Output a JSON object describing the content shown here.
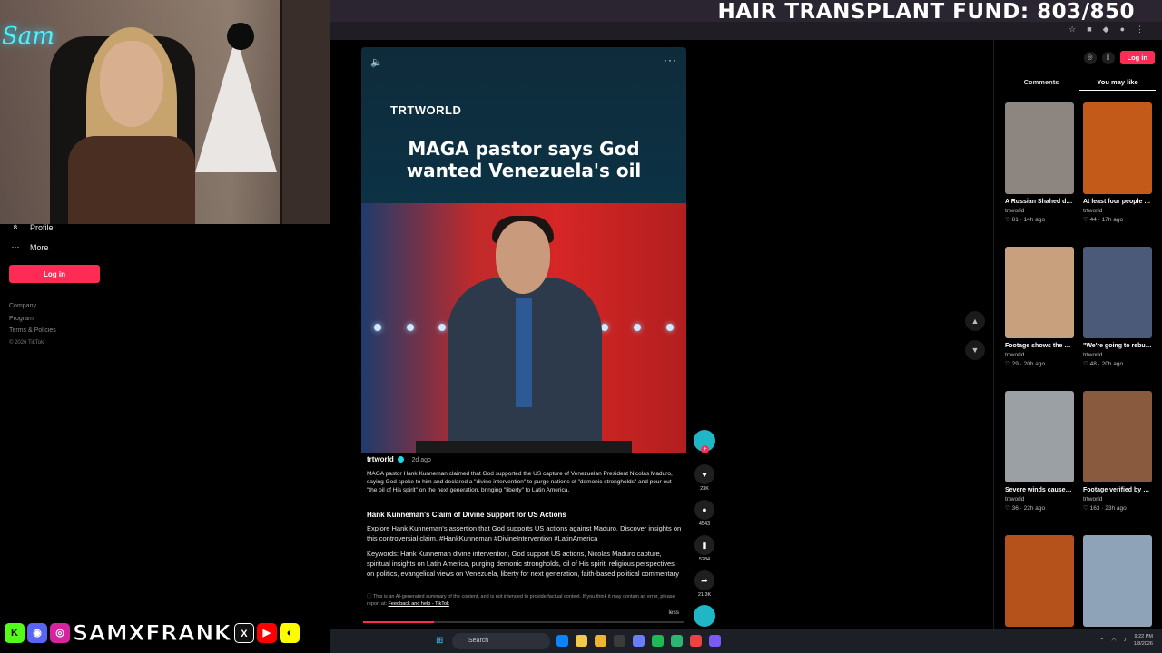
{
  "overlay": {
    "fund_title": "HAIR TRANSPLANT FUND: 803/850",
    "neon_sign": "Sam",
    "handle": "SAMXFRANK"
  },
  "sidebar": {
    "items": [
      {
        "label": "Profile",
        "icon": "person-icon"
      },
      {
        "label": "More",
        "icon": "more-dots-icon"
      }
    ],
    "login_label": "Log in",
    "footer": [
      "Company",
      "Program",
      "Terms & Policies"
    ],
    "copyright": "© 2026 TikTok"
  },
  "video": {
    "brand": "TRTWORLD",
    "headline_line1": "MAGA pastor says God",
    "headline_line2": "wanted Venezuela's oil"
  },
  "description": {
    "author": "trtworld",
    "time_ago": "2d ago",
    "caption": "MAGA pastor Hank Kunneman claimed that God supported the US capture of Venezuelan President Nicolas Maduro, saying God spoke to him and declared a \"divine intervention\" to purge nations of \"demonic strongholds\" and pour out \"the oil of His spirit\" on the next generation, bringing \"liberty\" to Latin America.",
    "section_title": "Hank Kunneman's Claim of Divine Support for US Actions",
    "section_body": "Explore Hank Kunneman's assertion that God supports US actions against Maduro. Discover insights on this controversial claim. #HankKunneman #DivineIntervention #LatinAmerica",
    "keywords": "Keywords: Hank Kunneman divine intervention, God support US actions, Nicolas Maduro capture, spiritual insights on Latin America, purging demonic strongholds, oil of His spirit, religious perspectives on politics, evangelical views on Venezuela, liberty for next generation, faith-based political commentary",
    "ai_note": "This is an AI-generated summary of the content, and is not intended to provide factual context. If you think it may contain an error, please report at:",
    "ai_link": "Feedback and help - TikTok",
    "less_label": "less",
    "progress": 0.22
  },
  "actions": {
    "likes": "23K",
    "comments": "4543",
    "saves": "5284",
    "shares": "21.3K"
  },
  "right_panel": {
    "login_label": "Log in",
    "tabs": [
      "Comments",
      "You may like"
    ],
    "active_tab": "You may like",
    "cards": [
      {
        "title": "A Russian Shahed drone attack hit...",
        "author": "trtworld",
        "likes": "81",
        "ago": "14h ago",
        "color": "#8c8580"
      },
      {
        "title": "At least four people were kille...",
        "author": "trtworld",
        "likes": "44",
        "ago": "17h ago",
        "color": "#c45a1a"
      },
      {
        "title": "Footage shows the moment...",
        "author": "trtworld",
        "likes": "29",
        "ago": "20h ago",
        "color": "#c9a07e"
      },
      {
        "title": "\"We're going to rebuild the oil, an...",
        "author": "trtworld",
        "likes": "48",
        "ago": "20h ago",
        "color": "#4a5a78"
      },
      {
        "title": "Severe winds caused several...",
        "author": "trtworld",
        "likes": "36",
        "ago": "22h ago",
        "color": "#9aa0a4"
      },
      {
        "title": "Footage verified by Reuters show...",
        "author": "trtworld",
        "likes": "163",
        "ago": "23h ago",
        "color": "#8a5a3e"
      },
      {
        "title": "",
        "author": "",
        "likes": "",
        "ago": "",
        "color": "#b5521c"
      },
      {
        "title": "",
        "author": "",
        "likes": "",
        "ago": "",
        "color": "#8fa3b8"
      }
    ]
  },
  "taskbar": {
    "search_placeholder": "Search",
    "time": "9:22 PM",
    "date": "1/8/2026"
  },
  "colors": {
    "accent": "#fe2c55",
    "verified": "#20d5ec"
  }
}
